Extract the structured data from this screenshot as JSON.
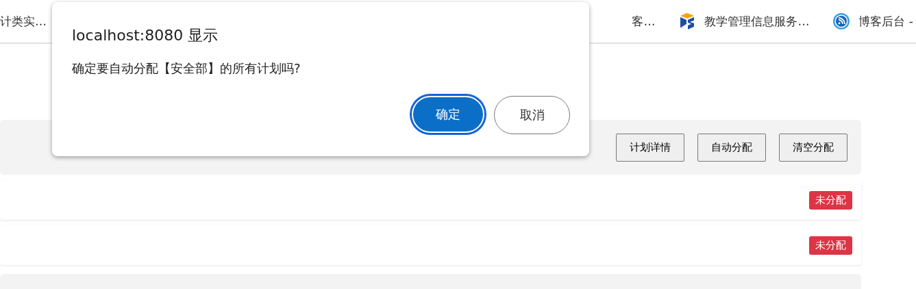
{
  "bookmarks": [
    {
      "label": "计类实…",
      "kind": "plain"
    },
    {
      "label": "客…",
      "kind": "plain"
    },
    {
      "label": "教学管理信息服务…",
      "kind": "cube"
    },
    {
      "label": "博客后台 -",
      "kind": "feed"
    }
  ],
  "plan_panel": {
    "buttons": [
      "计划详情",
      "自动分配",
      "清空分配"
    ]
  },
  "rows": [
    {
      "status": "未分配",
      "kind": "unassigned"
    },
    {
      "status": "未分配",
      "kind": "unassigned"
    }
  ],
  "dialog": {
    "title": "localhost:8080 显示",
    "message": "确定要自动分配【安全部】的所有计划吗?",
    "buttons": [
      {
        "label": "确定",
        "selected": true
      },
      {
        "label": "取消",
        "selected": false
      }
    ]
  }
}
